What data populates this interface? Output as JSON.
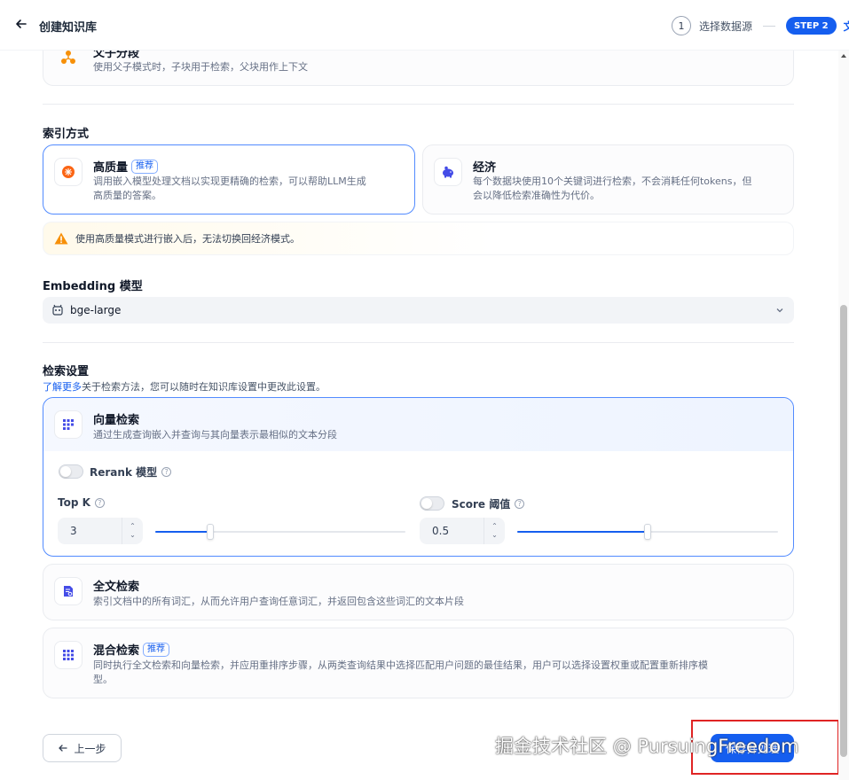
{
  "header": {
    "title": "创建知识库",
    "step1_number": "1",
    "step1_label": "选择数据源",
    "step2_badge": "STEP 2",
    "step2_label": "文"
  },
  "parent_child": {
    "title": "父子分段",
    "desc": "使用父子模式时，子块用于检索，父块用作上下文"
  },
  "index_method": {
    "title": "索引方式",
    "high_quality": {
      "title": "高质量",
      "badge": "推荐",
      "desc_line1": "调用嵌入模型处理文档以实现更精确的检索，可以帮助LLM生成",
      "desc_line2": "高质量的答案。"
    },
    "economy": {
      "title": "经济",
      "desc_line1": "每个数据块使用10个关键词进行检索，不会消耗任何tokens，但",
      "desc_line2": "会以降低检索准确性为代价。"
    },
    "warning": "使用高质量模式进行嵌入后，无法切换回经济模式。"
  },
  "embedding": {
    "title": "Embedding 模型",
    "value": "bge-large"
  },
  "retrieval": {
    "title": "检索设置",
    "learn_more": "了解更多",
    "learn_desc": "关于检索方法，您可以随时在知识库设置中更改此设置。",
    "vector": {
      "title": "向量检索",
      "desc": "通过生成查询嵌入并查询与其向量表示最相似的文本分段",
      "rerank_label": "Rerank 模型",
      "topk_label": "Top K",
      "topk_value": "3",
      "topk_fraction": 0.22,
      "score_label": "Score 阈值",
      "score_value": "0.5",
      "score_fraction": 0.5
    },
    "fulltext": {
      "title": "全文检索",
      "desc": "索引文档中的所有词汇，从而允许用户查询任意词汇，并返回包含这些词汇的文本片段"
    },
    "hybrid": {
      "title": "混合检索",
      "badge": "推荐",
      "desc_line1": "同时执行全文检索和向量检索，并应用重排序步骤，从两类查询结果中选择匹配用户问题的最佳结果，用户可以选择设置权重或配置重新排序模",
      "desc_line2": "型。"
    }
  },
  "footer": {
    "prev": "上一步",
    "next": "保存并处理"
  },
  "watermark": "掘金技术社区 @ PursuingFreedom"
}
